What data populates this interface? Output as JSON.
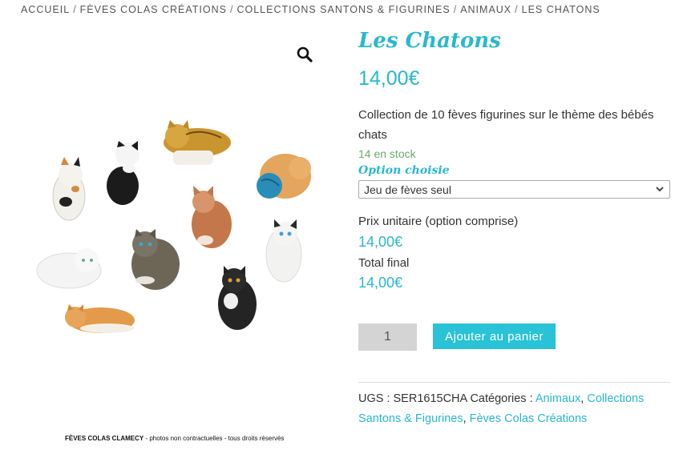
{
  "breadcrumb": {
    "items": [
      "ACCUEIL",
      "FÈVES COLAS CRÉATIONS",
      "COLLECTIONS SANTONS & FIGURINES",
      "ANIMAUX",
      "LES CHATONS"
    ],
    "separator": "/"
  },
  "gallery": {
    "zoom_icon": "magnifier-icon",
    "caption_brand": "FÈVES COLAS CLAMECY",
    "caption_text": " - photos non contractuelles - tous droits réservés"
  },
  "product": {
    "title": "Les Chatons",
    "price": "14,00€",
    "description": "Collection de 10 fèves figurines sur le thème des bébés chats",
    "stock": "14 en stock",
    "option_label": "Option choisie",
    "option_selected": "Jeu de fèves seul",
    "unit_price_label": "Prix unitaire (option comprise)",
    "unit_price": "14,00€",
    "total_label": "Total final",
    "total_price": "14,00€",
    "quantity": "1",
    "add_to_cart": "Ajouter au panier"
  },
  "meta": {
    "sku_label": "UGS :",
    "sku": "SER1615CHA",
    "categories_label": "Catégories :",
    "categories": [
      "Animaux",
      "Collections Santons & Figurines",
      "Fèves Colas Créations"
    ]
  },
  "colors": {
    "accent": "#29b8cf",
    "button": "#29c2d6",
    "stock": "#6ea86e"
  }
}
